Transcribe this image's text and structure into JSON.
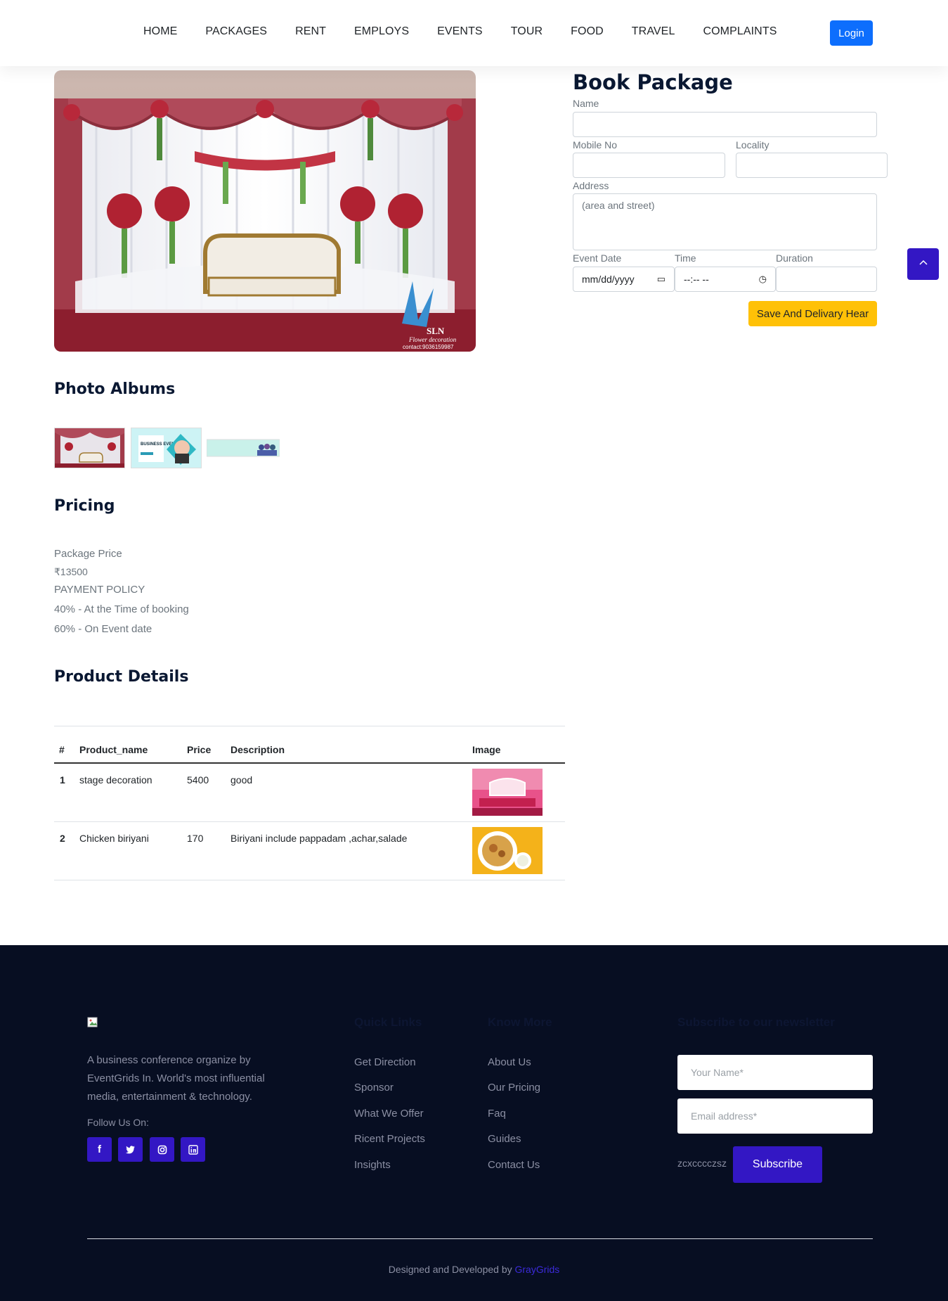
{
  "nav": {
    "links": [
      "HOME",
      "PACKAGES",
      "RENT",
      "EMPLOYS",
      "EVENTS",
      "TOUR",
      "FOOD",
      "TRAVEL",
      "COMPLAINTS"
    ],
    "login_label": "Login"
  },
  "hero": {
    "watermark_title": "SLN",
    "watermark_sub": "Flower decoration",
    "watermark_contact": "contact:9036159987"
  },
  "photo_albums": {
    "title": "Photo Albums",
    "thumb2_caption": "BUSINESS EVENT"
  },
  "pricing": {
    "title": "Pricing",
    "package_price_label": "Package Price",
    "package_price": "₹13500",
    "policy_label": "PAYMENT POLICY",
    "policy_lines": [
      "40% - At the Time of booking",
      "60% - On Event date"
    ]
  },
  "product_details": {
    "title": "Product Details",
    "columns": [
      "#",
      "Product_name",
      "Price",
      "Description",
      "Image"
    ],
    "rows": [
      {
        "num": "1",
        "name": "stage decoration",
        "price": "5400",
        "description": "good"
      },
      {
        "num": "2",
        "name": "Chicken biriyani",
        "price": "170",
        "description": "Biriyani include pappadam ,achar,salade"
      }
    ]
  },
  "book": {
    "title": "Book Package",
    "name_label": "Name",
    "mobile_label": "Mobile No",
    "locality_label": "Locality",
    "address_label": "Address",
    "address_placeholder": "(area and street)",
    "event_date_label": "Event Date",
    "event_date_value": "mm/dd/yyyy",
    "time_label": "Time",
    "time_value": "--:-- --",
    "duration_label": "Duration",
    "save_label": "Save And Delivary Hear"
  },
  "footer": {
    "description": "A business conference organize by EventGrids In. World's most influential media, entertainment & technology.",
    "follow_label": "Follow Us On:",
    "social_icons": [
      "facebook-icon",
      "twitter-icon",
      "instagram-icon",
      "linkedin-icon"
    ],
    "quick_links_title": "Quick Links",
    "quick_links": [
      "Get Direction",
      "Sponsor",
      "What We Offer",
      "Ricent Projects",
      "Insights"
    ],
    "know_more_title": "Know More",
    "know_more": [
      "About Us",
      "Our Pricing",
      "Faq",
      "Guides",
      "Contact Us"
    ],
    "newsletter_title": "Subscribe to our newsletter",
    "name_placeholder": "Your Name*",
    "email_placeholder": "Email address*",
    "captcha_text": "zcxcccczsz",
    "subscribe_label": "Subscribe",
    "credit_prefix": "Designed and Developed by",
    "credit_link": "GrayGrids"
  },
  "colors": {
    "primary_blue": "#0d6efd",
    "accent_purple": "#3317c4",
    "warning_yellow": "#ffc107",
    "footer_bg": "#070e22",
    "heading": "#0a1832"
  }
}
